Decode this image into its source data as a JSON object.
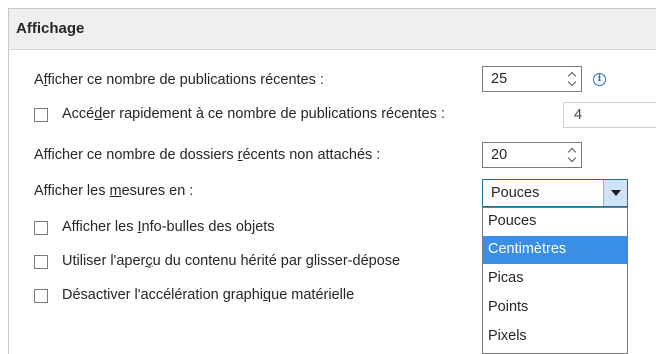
{
  "section": {
    "title": "Affichage"
  },
  "rows": {
    "recent_docs": {
      "label_pre": "A",
      "label_u": "f",
      "label_post": "ficher ce nombre de publications récentes :",
      "value": "25"
    },
    "quick_access": {
      "label_pre": "Accé",
      "label_u": "d",
      "label_post": "er rapidement à ce nombre de publications récentes :",
      "value": "4",
      "checked": false,
      "enabled": false
    },
    "recent_folders": {
      "label_pre": "Afficher ce nombre de dossiers ",
      "label_u": "r",
      "label_post": "écents non attachés :",
      "value": "20"
    },
    "units": {
      "label_pre": "Afficher les ",
      "label_u": "m",
      "label_post": "esures en :",
      "selected": "Pouces",
      "options": [
        "Pouces",
        "Centimètres",
        "Picas",
        "Points",
        "Pixels"
      ],
      "highlighted_option": "Centimètres"
    },
    "tooltips": {
      "label_pre": "Afficher les ",
      "label_u": "I",
      "label_post": "nfo-bulles des objets",
      "checked": false
    },
    "preview": {
      "label_pre": "Utiliser l'aper",
      "label_u": "ç",
      "label_post": "u du contenu hérité par glisser-dépose",
      "checked": false
    },
    "hw_accel": {
      "label_pre": "Désactiver l'accélération graphi",
      "label_u": "q",
      "label_post": "ue matérielle",
      "checked": false
    }
  },
  "icons": {
    "info": "info-icon",
    "info_glyph": "i",
    "info_color": "#2b6fb7"
  },
  "colors": {
    "header_bg": "#efefef",
    "highlight": "#3a8ee6",
    "select_button": "#cfe3f7"
  }
}
